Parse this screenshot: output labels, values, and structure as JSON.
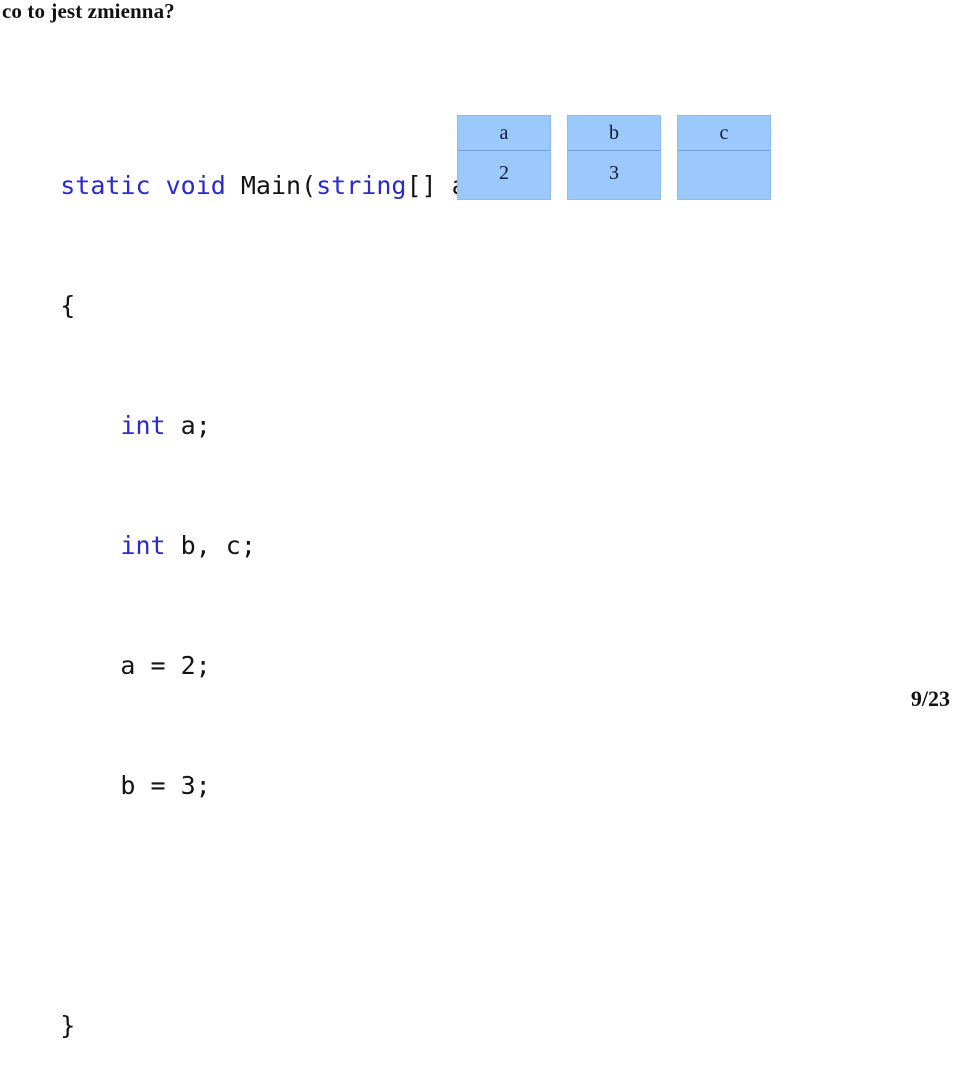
{
  "slide": {
    "title": "co to jest zmienna?",
    "page_label": "9/23",
    "background_color": "#ffffff"
  },
  "code": {
    "keyword_color": "#2a2ad0",
    "text_color": "#141414",
    "lines": [
      {
        "id": "line-signature",
        "segments": [
          {
            "text": "static",
            "kind": "keyword"
          },
          {
            "text": " ",
            "kind": "plain"
          },
          {
            "text": "void",
            "kind": "keyword"
          },
          {
            "text": " Main(",
            "kind": "plain"
          },
          {
            "text": "string",
            "kind": "keyword"
          },
          {
            "text": "[] args)",
            "kind": "plain"
          }
        ],
        "plain": "static void Main(string[] args)"
      },
      {
        "id": "line-open-brace",
        "segments": [
          {
            "text": "{",
            "kind": "plain"
          }
        ],
        "plain": "{"
      },
      {
        "id": "line-declare-a",
        "segments": [
          {
            "text": "    ",
            "kind": "plain"
          },
          {
            "text": "int",
            "kind": "keyword"
          },
          {
            "text": " a;",
            "kind": "plain"
          }
        ],
        "plain": "    int a;"
      },
      {
        "id": "line-declare-b-c",
        "segments": [
          {
            "text": "    ",
            "kind": "plain"
          },
          {
            "text": "int",
            "kind": "keyword"
          },
          {
            "text": " b, c;",
            "kind": "plain"
          }
        ],
        "plain": "    int b, c;"
      },
      {
        "id": "line-assign-a",
        "segments": [
          {
            "text": "    a = 2;",
            "kind": "plain"
          }
        ],
        "plain": "    a = 2;"
      },
      {
        "id": "line-assign-b",
        "segments": [
          {
            "text": "    b = 3;",
            "kind": "plain"
          }
        ],
        "plain": "    b = 3;"
      },
      {
        "id": "line-blank",
        "segments": [],
        "plain": ""
      },
      {
        "id": "line-close-brace",
        "segments": [
          {
            "text": "}",
            "kind": "plain"
          }
        ],
        "plain": "}"
      }
    ]
  },
  "diagram": {
    "fill_color": "#9cc9fb",
    "border_color": "#8cbdf2",
    "divider_color": "#6d9fd6",
    "text_color": "#101935",
    "boxes": [
      {
        "name": "a",
        "value": "2"
      },
      {
        "name": "b",
        "value": "3"
      },
      {
        "name": "c",
        "value": ""
      }
    ]
  }
}
